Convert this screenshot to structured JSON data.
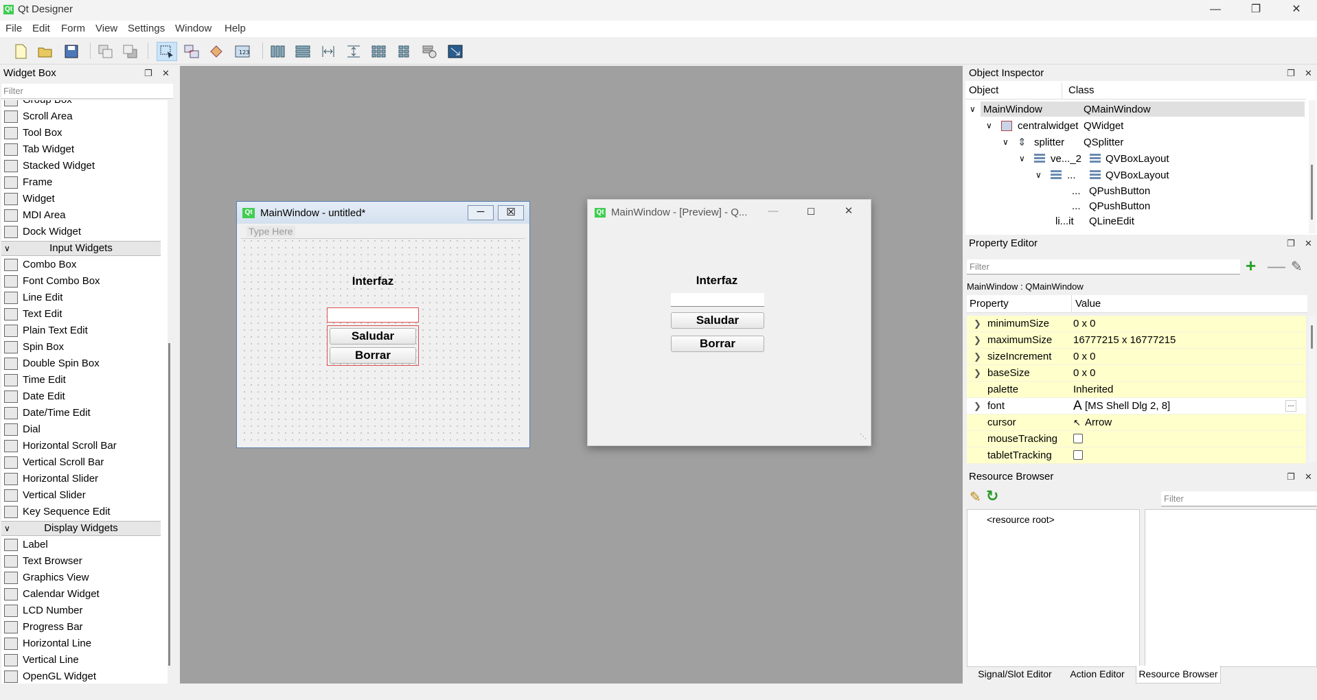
{
  "app": {
    "title": "Qt Designer",
    "logo": "Qt"
  },
  "menu": [
    "File",
    "Edit",
    "Form",
    "View",
    "Settings",
    "Window",
    "Help"
  ],
  "widget_box": {
    "title": "Widget Box",
    "filter_placeholder": "Filter",
    "partial_item": "Group Box",
    "containers": [
      "Scroll Area",
      "Tool Box",
      "Tab Widget",
      "Stacked Widget",
      "Frame",
      "Widget",
      "MDI Area",
      "Dock Widget"
    ],
    "input_category": "Input Widgets",
    "input_widgets": [
      "Combo Box",
      "Font Combo Box",
      "Line Edit",
      "Text Edit",
      "Plain Text Edit",
      "Spin Box",
      "Double Spin Box",
      "Time Edit",
      "Date Edit",
      "Date/Time Edit",
      "Dial",
      "Horizontal Scroll Bar",
      "Vertical Scroll Bar",
      "Horizontal Slider",
      "Vertical Slider",
      "Key Sequence Edit"
    ],
    "display_category": "Display Widgets",
    "display_widgets": [
      "Label",
      "Text Browser",
      "Graphics View",
      "Calendar Widget",
      "LCD Number",
      "Progress Bar",
      "Horizontal Line",
      "Vertical Line",
      "OpenGL Widget"
    ]
  },
  "design_form": {
    "title": "MainWindow - untitled*",
    "menu_placeholder": "Type Here",
    "label": "Interfaz",
    "button1": "Saludar",
    "button2": "Borrar"
  },
  "preview": {
    "title": "MainWindow - [Preview] - Q...",
    "label": "Interfaz",
    "button1": "Saludar",
    "button2": "Borrar"
  },
  "object_inspector": {
    "title": "Object Inspector",
    "col_object": "Object",
    "col_class": "Class",
    "rows": [
      {
        "object": "MainWindow",
        "class": "QMainWindow"
      },
      {
        "object": "centralwidget",
        "class": "QWidget"
      },
      {
        "object": "splitter",
        "class": "QSplitter"
      },
      {
        "object": "ve..._2",
        "class": "QVBoxLayout"
      },
      {
        "object": "...",
        "class": "QVBoxLayout"
      },
      {
        "object": "...",
        "class": "QPushButton"
      },
      {
        "object": "...",
        "class": "QPushButton"
      },
      {
        "object": "li...it",
        "class": "QLineEdit"
      }
    ]
  },
  "property_editor": {
    "title": "Property Editor",
    "filter_placeholder": "Filter",
    "context": "MainWindow : QMainWindow",
    "col_property": "Property",
    "col_value": "Value",
    "rows": [
      {
        "name": "minimumSize",
        "value": "0 x 0"
      },
      {
        "name": "maximumSize",
        "value": "16777215 x 16777215"
      },
      {
        "name": "sizeIncrement",
        "value": "0 x 0"
      },
      {
        "name": "baseSize",
        "value": "0 x 0"
      },
      {
        "name": "palette",
        "value": "Inherited"
      },
      {
        "name": "font",
        "value": "[MS Shell Dlg 2, 8]"
      },
      {
        "name": "cursor",
        "value": "Arrow"
      },
      {
        "name": "mouseTracking",
        "value": ""
      },
      {
        "name": "tabletTracking",
        "value": ""
      }
    ]
  },
  "resource_browser": {
    "title": "Resource Browser",
    "filter_placeholder": "Filter",
    "root": "<resource root>"
  },
  "bottom_tabs": [
    "Signal/Slot Editor",
    "Action Editor",
    "Resource Browser"
  ],
  "colors": {
    "accent": "#1a73c7",
    "property_highlight": "#ffffcc",
    "mdi_background": "#a0a0a0",
    "selection_border": "#e05050"
  }
}
